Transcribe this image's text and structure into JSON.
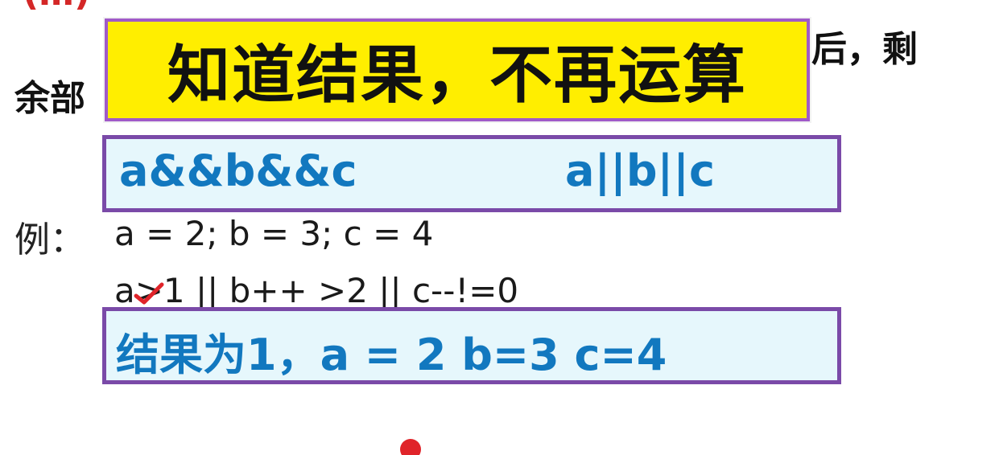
{
  "slide": {
    "top_fragment": "(…)",
    "background_suffix": "后，剩",
    "background_prefix": "余部",
    "title": "知道结果，不再运算",
    "operators": {
      "and_chain": "a&&b&&c",
      "or_chain": "a||b||c"
    },
    "example_label": "例：",
    "assignment_line": "a = 2;   b = 3; c = 4",
    "expression_line": "a>1 || b++ >2 || c--!=0",
    "result": "结果为1，a = 2   b=3 c=4",
    "colors": {
      "title_bg": "#ffee00",
      "box_border": "#7a4aa8",
      "box_bg": "#e6f7fc",
      "blue_text": "#1278bf",
      "annotation_red": "#e0242a"
    }
  }
}
